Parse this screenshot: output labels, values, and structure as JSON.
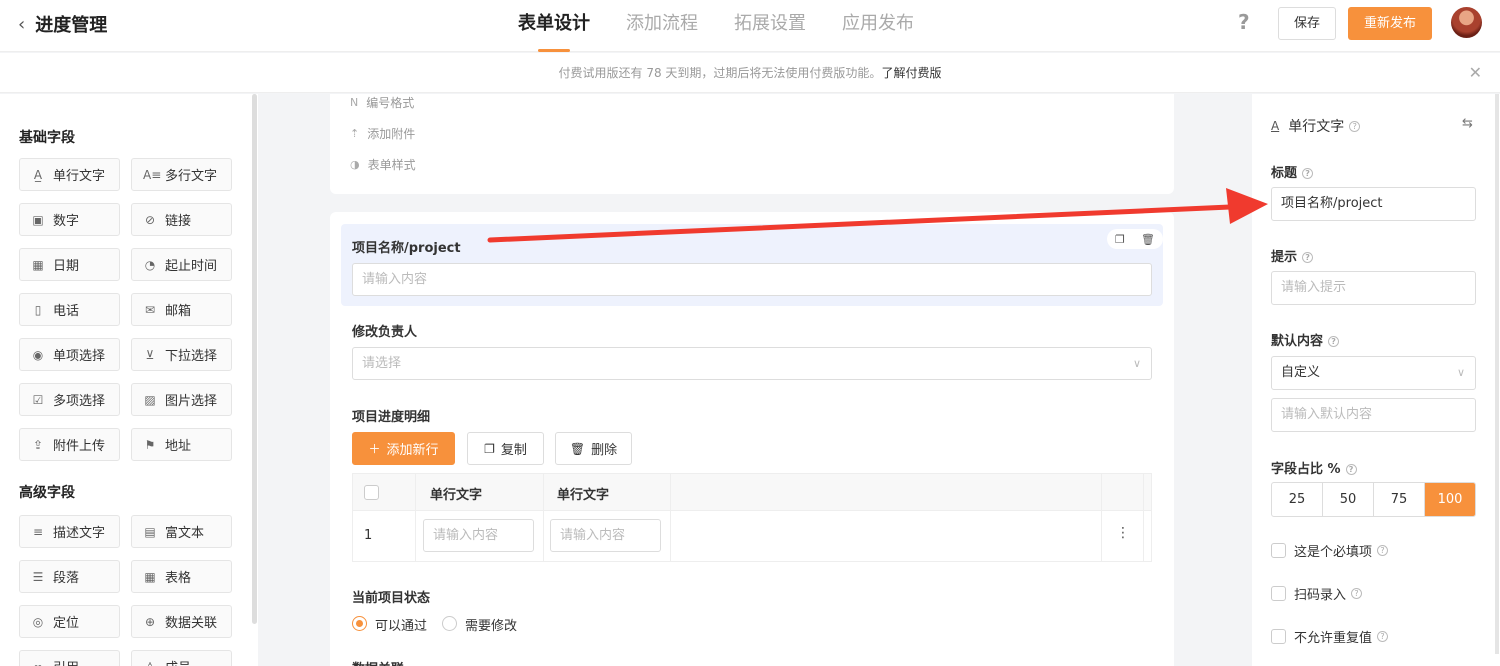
{
  "header": {
    "back_title": "进度管理",
    "tabs": [
      {
        "label": "表单设计"
      },
      {
        "label": "添加流程"
      },
      {
        "label": "拓展设置"
      },
      {
        "label": "应用发布"
      }
    ],
    "help": "?",
    "save_label": "保存",
    "publish_label": "重新发布"
  },
  "notice": {
    "text": "付费试用版还有 78 天到期，过期后将无法使用付费版功能。",
    "link": "了解付费版",
    "close": "✕"
  },
  "sidebar": {
    "basic_title": "基础字段",
    "basic_fields": [
      {
        "label": "单行文字",
        "icon": "A̲"
      },
      {
        "label": "多行文字",
        "icon": "A≡"
      },
      {
        "label": "数字",
        "icon": "▣"
      },
      {
        "label": "链接",
        "icon": "⊘"
      },
      {
        "label": "日期",
        "icon": "▦"
      },
      {
        "label": "起止时间",
        "icon": "◔"
      },
      {
        "label": "电话",
        "icon": "▯"
      },
      {
        "label": "邮箱",
        "icon": "✉"
      },
      {
        "label": "单项选择",
        "icon": "◉"
      },
      {
        "label": "下拉选择",
        "icon": "⊻"
      },
      {
        "label": "多项选择",
        "icon": "☑"
      },
      {
        "label": "图片选择",
        "icon": "▨"
      },
      {
        "label": "附件上传",
        "icon": "⇪"
      },
      {
        "label": "地址",
        "icon": "⚑"
      }
    ],
    "advanced_title": "高级字段",
    "advanced_fields": [
      {
        "label": "描述文字",
        "icon": "≡"
      },
      {
        "label": "富文本",
        "icon": "▤"
      },
      {
        "label": "段落",
        "icon": "☰"
      },
      {
        "label": "表格",
        "icon": "▦"
      },
      {
        "label": "定位",
        "icon": "◎"
      },
      {
        "label": "数据关联",
        "icon": "⊕"
      },
      {
        "label": "引用",
        "icon": "∞"
      },
      {
        "label": "成员",
        "icon": "♙"
      }
    ]
  },
  "form": {
    "options": [
      {
        "label": "编号格式",
        "icon": "N"
      },
      {
        "label": "添加附件",
        "icon": "⇡"
      },
      {
        "label": "表单样式",
        "icon": "◑"
      }
    ],
    "project_name_label": "项目名称/project",
    "project_name_placeholder": "请输入内容",
    "owner_label": "修改负责人",
    "owner_placeholder": "请选择",
    "detail_label": "项目进度明细",
    "add_row": "添加新行",
    "copy": "复制",
    "delete": "删除",
    "table": {
      "headers": [
        "单行文字",
        "单行文字"
      ],
      "row_number": "1",
      "cell_placeholder": "请输入内容",
      "more": "⋮"
    },
    "status_label": "当前项目状态",
    "status_options": [
      "可以通过",
      "需要修改"
    ],
    "next_label": "数据关联"
  },
  "properties": {
    "field_type": "单行文字",
    "title_label": "标题",
    "title_value": "项目名称/project",
    "hint_label": "提示",
    "hint_placeholder": "请输入提示",
    "default_label": "默认内容",
    "default_select": "自定义",
    "default_placeholder": "请输入默认内容",
    "width_label": "字段占比 %",
    "width_options": [
      "25",
      "50",
      "75",
      "100"
    ],
    "width_selected": "100",
    "checks": [
      "这是个必填项",
      "扫码录入",
      "不允许重复值"
    ]
  },
  "colors": {
    "accent": "#f7913c",
    "arrow": "#f03a2e",
    "selected_bg": "#eef2fd"
  }
}
